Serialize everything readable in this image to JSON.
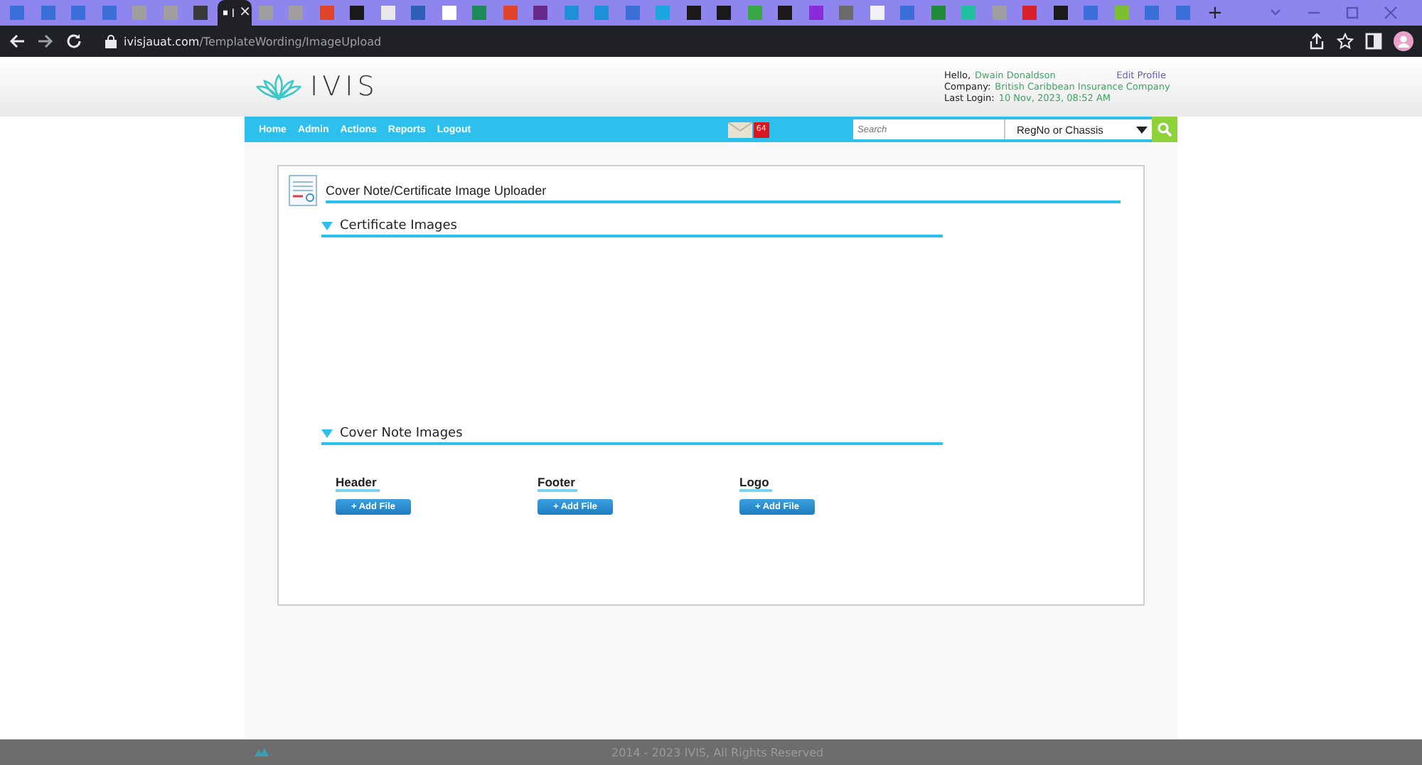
{
  "browser": {
    "tabs": [
      {
        "color": "#3b6fd8",
        "selected": false
      },
      {
        "color": "#3b6fd8",
        "selected": false
      },
      {
        "color": "#3b6fd8",
        "selected": false
      },
      {
        "color": "#3b6fd8",
        "selected": false
      },
      {
        "color": "#9e9e9e",
        "selected": false
      },
      {
        "color": "#9e9e9e",
        "selected": false
      },
      {
        "color": "#3a3a3a",
        "selected": false
      },
      {
        "color": "#ffffff",
        "selected": true,
        "label": "I"
      },
      {
        "color": "#9e9e9e",
        "selected": false
      },
      {
        "color": "#9e9e9e",
        "selected": false
      },
      {
        "color": "#e0442b",
        "selected": false
      },
      {
        "color": "#1a1a1a",
        "selected": false
      },
      {
        "color": "#e8e8e8",
        "selected": false
      },
      {
        "color": "#2d5fb8",
        "selected": false
      },
      {
        "color": "#ffffff",
        "selected": false
      },
      {
        "color": "#1e8a5a",
        "selected": false
      },
      {
        "color": "#e0442b",
        "selected": false
      },
      {
        "color": "#6a2a8a",
        "selected": false
      },
      {
        "color": "#1e90d8",
        "selected": false
      },
      {
        "color": "#1e90d8",
        "selected": false
      },
      {
        "color": "#3b6fd8",
        "selected": false
      },
      {
        "color": "#1aa7e0",
        "selected": false
      },
      {
        "color": "#1a1a1a",
        "selected": false
      },
      {
        "color": "#1a1a1a",
        "selected": false
      },
      {
        "color": "#38a845",
        "selected": false
      },
      {
        "color": "#1a1a1a",
        "selected": false
      },
      {
        "color": "#8a2ad8",
        "selected": false
      },
      {
        "color": "#6a6a6a",
        "selected": false
      },
      {
        "color": "#f2f2f2",
        "selected": false
      },
      {
        "color": "#3b6fd8",
        "selected": false
      },
      {
        "color": "#1e8a3a",
        "selected": false
      },
      {
        "color": "#20c0a0",
        "selected": false
      },
      {
        "color": "#9e9e9e",
        "selected": false
      },
      {
        "color": "#d8202a",
        "selected": false
      },
      {
        "color": "#1a1a1a",
        "selected": false
      },
      {
        "color": "#3b6fd8",
        "selected": false
      },
      {
        "color": "#7ac030",
        "selected": false
      },
      {
        "color": "#3b6fd8",
        "selected": false
      },
      {
        "color": "#3b6fd8",
        "selected": false
      }
    ],
    "close_tab": "×",
    "new_tab": "+",
    "url_host": "ivisjauat.com",
    "url_path": "/TemplateWording/ImageUpload"
  },
  "header": {
    "logo": "IVIS",
    "greeting_label": "Hello,",
    "user": "Dwain Donaldson",
    "edit_profile": "Edit Profile",
    "company_label": "Company:",
    "company": "British Caribbean Insurance Company",
    "last_login_label": "Last Login:",
    "last_login": "10 Nov, 2023, 08:52 AM"
  },
  "nav": {
    "items": [
      "Home",
      "Admin",
      "Actions",
      "Reports",
      "Logout"
    ],
    "mail_count": "64",
    "search": {
      "placeholder": "Search"
    },
    "search_type": "RegNo or Chassis"
  },
  "panel": {
    "title": "Cover Note/Certificate Image Uploader",
    "sections": [
      {
        "title": "Certificate Images",
        "expanded": true
      },
      {
        "title": "Cover Note Images",
        "expanded": true,
        "uploads": [
          {
            "label": "Header",
            "button": "+ Add File"
          },
          {
            "label": "Footer",
            "button": "+ Add File"
          },
          {
            "label": "Logo",
            "button": "+ Add File"
          }
        ]
      }
    ]
  },
  "footer": {
    "text": "2014 - 2023 IVIS, All Rights Reserved"
  }
}
